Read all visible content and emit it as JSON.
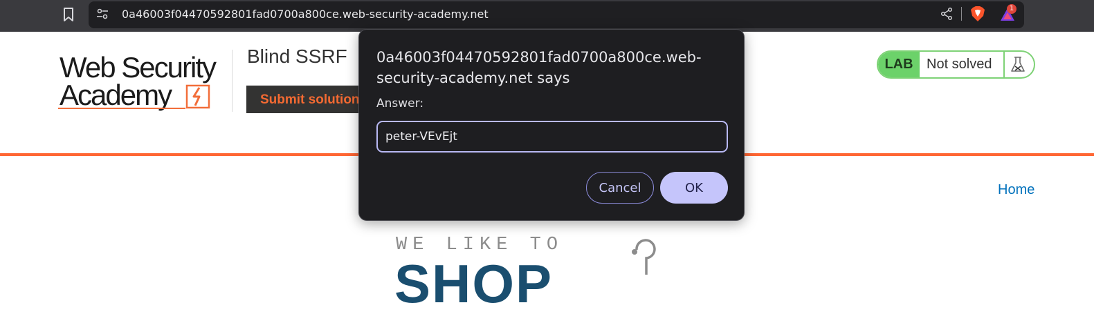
{
  "browser": {
    "url": "0a46003f04470592801fad0700a800ce.web-security-academy.net",
    "rewards_count": "1",
    "icons": [
      "bookmark-icon",
      "site-info-icon",
      "share-icon",
      "brave-shield-icon",
      "brave-rewards-icon"
    ]
  },
  "header": {
    "logo_line1": "Web Security",
    "logo_line2": "Academy",
    "lab_title": "Blind SSRF",
    "submit_label": "Submit solution",
    "lab_tag": "LAB",
    "lab_status": "Not solved"
  },
  "nav": {
    "home_label": "Home"
  },
  "banner": {
    "tagline": "WE LIKE TO",
    "word": "SHOP"
  },
  "dialog": {
    "title": "0a46003f04470592801fad0700a800ce.web-security-academy.net says",
    "label": "Answer:",
    "input_value": "peter-VEvEjt",
    "cancel_label": "Cancel",
    "ok_label": "OK"
  },
  "colors": {
    "accent_orange": "#ff6633",
    "lab_green": "#6cd26a",
    "link_blue": "#0071bc",
    "dialog_bg": "#1e1e21",
    "ok_button": "#c5c5fb"
  }
}
